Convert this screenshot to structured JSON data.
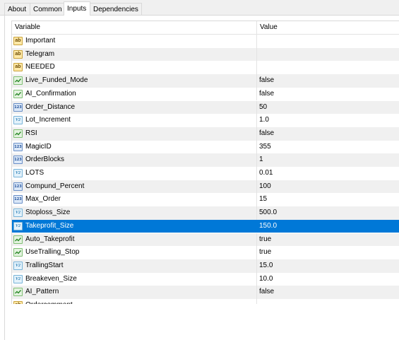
{
  "tabs": [
    {
      "label": "About",
      "active": false
    },
    {
      "label": "Common",
      "active": false
    },
    {
      "label": "Inputs",
      "active": true
    },
    {
      "label": "Dependencies",
      "active": false
    }
  ],
  "table": {
    "headers": {
      "variable": "Variable",
      "value": "Value"
    },
    "rows": [
      {
        "icon": "string-icon",
        "name": "Important",
        "value": ""
      },
      {
        "icon": "string-icon",
        "name": "Telegram",
        "value": ""
      },
      {
        "icon": "string-icon",
        "name": "NEEDED",
        "value": ""
      },
      {
        "icon": "bool-icon",
        "name": "Live_Funded_Mode",
        "value": "false"
      },
      {
        "icon": "bool-icon",
        "name": "AI_Confirmation",
        "value": "false"
      },
      {
        "icon": "int-icon",
        "name": "Order_Distance",
        "value": "50"
      },
      {
        "icon": "double-icon",
        "name": "Lot_Increment",
        "value": "1.0"
      },
      {
        "icon": "bool-icon",
        "name": "RSI",
        "value": "false"
      },
      {
        "icon": "int-icon",
        "name": "MagicID",
        "value": "355"
      },
      {
        "icon": "int-icon",
        "name": "OrderBlocks",
        "value": "1"
      },
      {
        "icon": "double-icon",
        "name": "LOTS",
        "value": "0.01"
      },
      {
        "icon": "int-icon",
        "name": "Compund_Percent",
        "value": "100"
      },
      {
        "icon": "int-icon",
        "name": "Max_Order",
        "value": "15"
      },
      {
        "icon": "double-icon",
        "name": "Stoploss_Size",
        "value": "500.0"
      },
      {
        "icon": "double-icon",
        "name": "Takeprofit_Size",
        "value": "150.0",
        "selected": true
      },
      {
        "icon": "bool-icon",
        "name": "Auto_Takeprofit",
        "value": "true"
      },
      {
        "icon": "bool-icon",
        "name": "UseTralling_Stop",
        "value": "true"
      },
      {
        "icon": "double-icon",
        "name": "TrallingStart",
        "value": "15.0"
      },
      {
        "icon": "double-icon",
        "name": "Breakeven_Size",
        "value": "10.0"
      },
      {
        "icon": "bool-icon",
        "name": "AI_Pattern",
        "value": "false"
      },
      {
        "icon": "string-icon",
        "name": "Ordercomment",
        "value": ""
      }
    ]
  },
  "colors": {
    "selection": "#0078d7",
    "alt_row": "#f0f0f0"
  }
}
